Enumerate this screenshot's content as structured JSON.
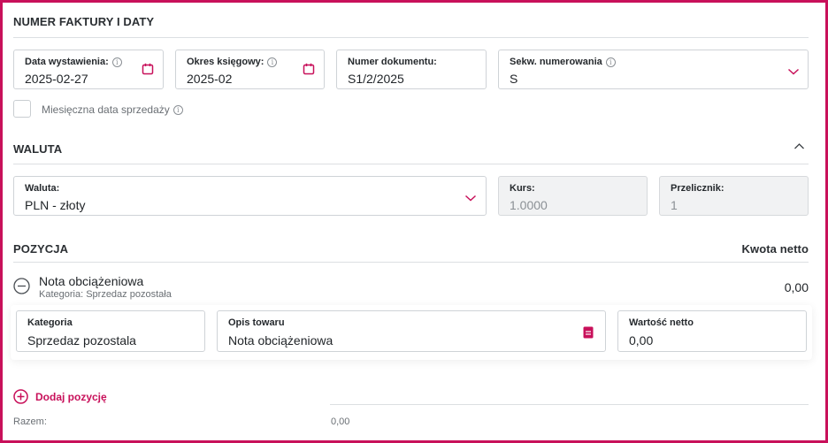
{
  "section_invoice": {
    "title": "NUMER FAKTURY I DATY",
    "issue_date": {
      "label": "Data wystawienia:",
      "value": "2025-02-27"
    },
    "accounting_period": {
      "label": "Okres księgowy:",
      "value": "2025-02"
    },
    "document_number": {
      "label": "Numer dokumentu:",
      "value": "S1/2/2025"
    },
    "numbering_sequence": {
      "label": "Sekw. numerowania",
      "value": "S"
    },
    "monthly_sale_date": {
      "label": "Miesięczna data sprzedaży"
    }
  },
  "section_currency": {
    "title": "WALUTA",
    "currency": {
      "label": "Waluta:",
      "value": "PLN - złoty"
    },
    "rate": {
      "label": "Kurs:",
      "value": "1.0000"
    },
    "converter": {
      "label": "Przelicznik:",
      "value": "1"
    }
  },
  "section_position": {
    "title": "POZYCJA",
    "net_amount_header": "Kwota netto",
    "item": {
      "name": "Nota obciążeniowa",
      "category_line": "Kategoria: Sprzedaz pozostała",
      "net_amount": "0,00",
      "category": {
        "label": "Kategoria",
        "value": "Sprzedaz pozostala"
      },
      "description": {
        "label": "Opis towaru",
        "value": "Nota obciążeniowa"
      },
      "net_value": {
        "label": "Wartość netto",
        "value": "0,00"
      }
    },
    "add_position": "Dodaj pozycję",
    "total_label": "Razem:",
    "total_value": "0,00"
  },
  "colors": {
    "accent": "#c8105a",
    "border": "#cfd3d7",
    "disabled_bg": "#f1f2f3"
  },
  "icons": {
    "info": "i"
  }
}
